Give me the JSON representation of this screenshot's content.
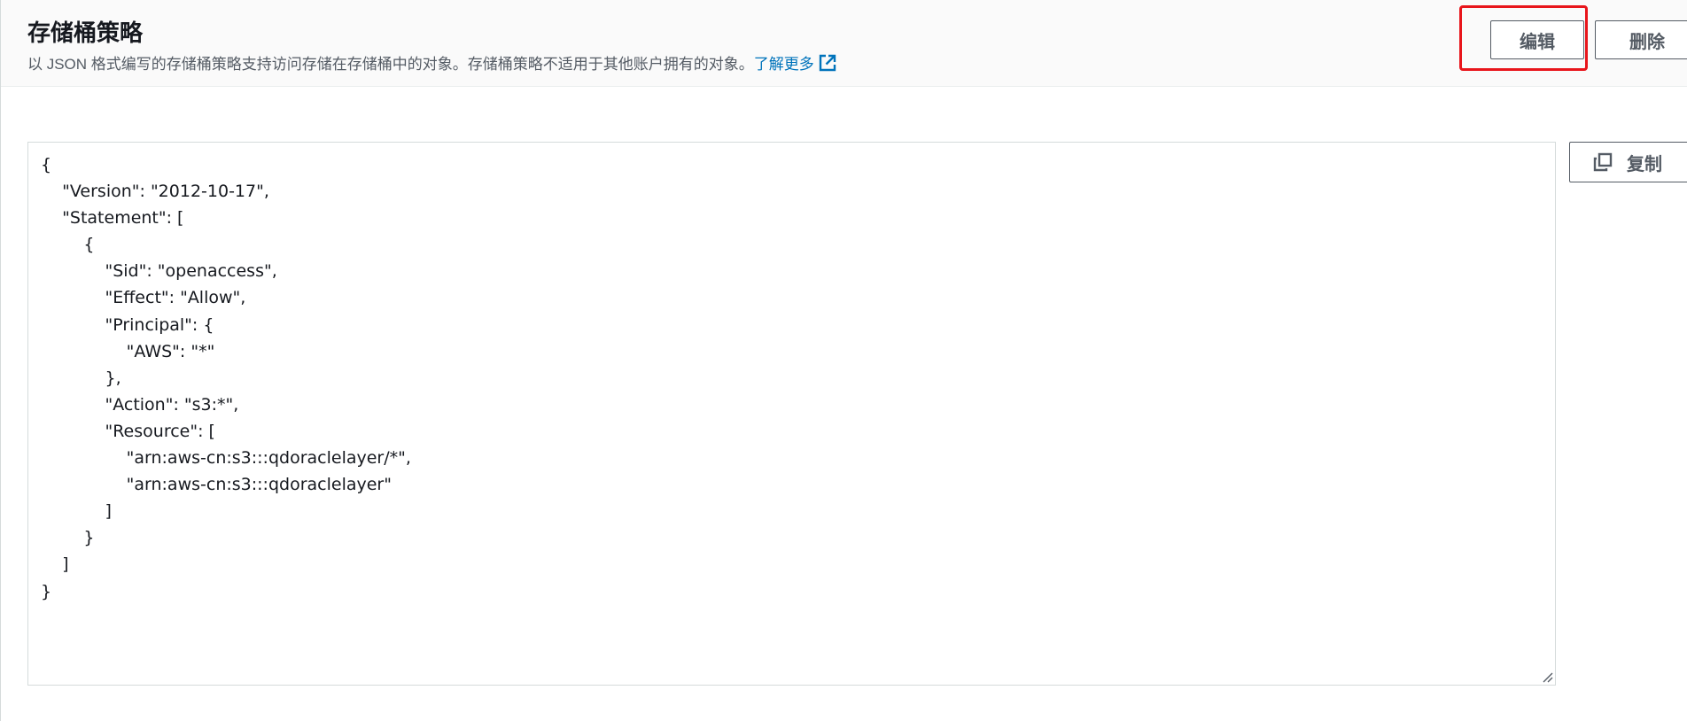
{
  "header": {
    "title": "存储桶策略",
    "description": "以 JSON 格式编写的存储桶策略支持访问存储在存储桶中的对象。存储桶策略不适用于其他账户拥有的对象。",
    "learn_more_label": "了解更多",
    "learn_more_icon": "external-link-icon",
    "edit_label": "编辑",
    "delete_label": "删除"
  },
  "editor": {
    "policy_json": "{\n    \"Version\": \"2012-10-17\",\n    \"Statement\": [\n        {\n            \"Sid\": \"openaccess\",\n            \"Effect\": \"Allow\",\n            \"Principal\": {\n                \"AWS\": \"*\"\n            },\n            \"Action\": \"s3:*\",\n            \"Resource\": [\n                \"arn:aws-cn:s3:::qdoraclelayer/*\",\n                \"arn:aws-cn:s3:::qdoraclelayer\"\n            ]\n        }\n    ]\n}",
    "copy_label": "复制",
    "copy_icon": "copy-icon"
  },
  "colors": {
    "link": "#0073bb",
    "highlight": "#e8151b",
    "button_border": "#545b64"
  }
}
